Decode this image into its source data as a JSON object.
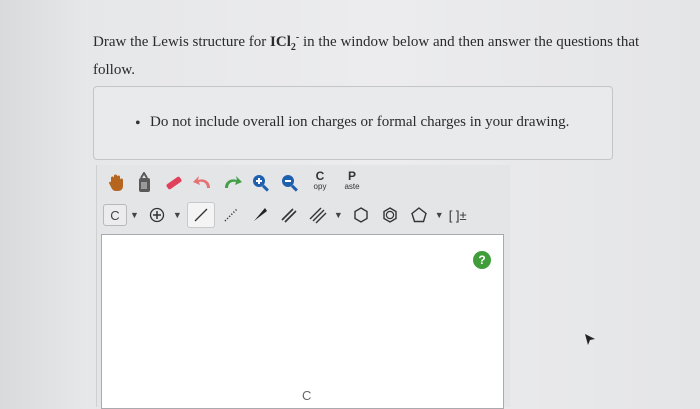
{
  "question": {
    "prefix": "Draw the Lewis structure for ",
    "formula_main": "ICl",
    "formula_sub": "2",
    "formula_sup": "-",
    "suffix": " in the window below and then answer the questions that follow."
  },
  "note": {
    "bullet": "•",
    "text": "Do not include overall ion charges or formal charges in your drawing."
  },
  "toolbar": {
    "row1": {
      "copy_big": "C",
      "copy_small": "opy",
      "paste_big": "P",
      "paste_small": "aste"
    },
    "row2": {
      "element": "C",
      "dropdown": "▼",
      "bracket": "[ ]±"
    }
  },
  "canvas": {
    "help": "?",
    "bottom_label": "C"
  },
  "colors": {
    "hand": "#b5651d",
    "eraser": "#e0405a",
    "undo": "#e57373",
    "redo": "#43a047",
    "zoom": "#1e5fae",
    "help": "#3f9e3a"
  }
}
